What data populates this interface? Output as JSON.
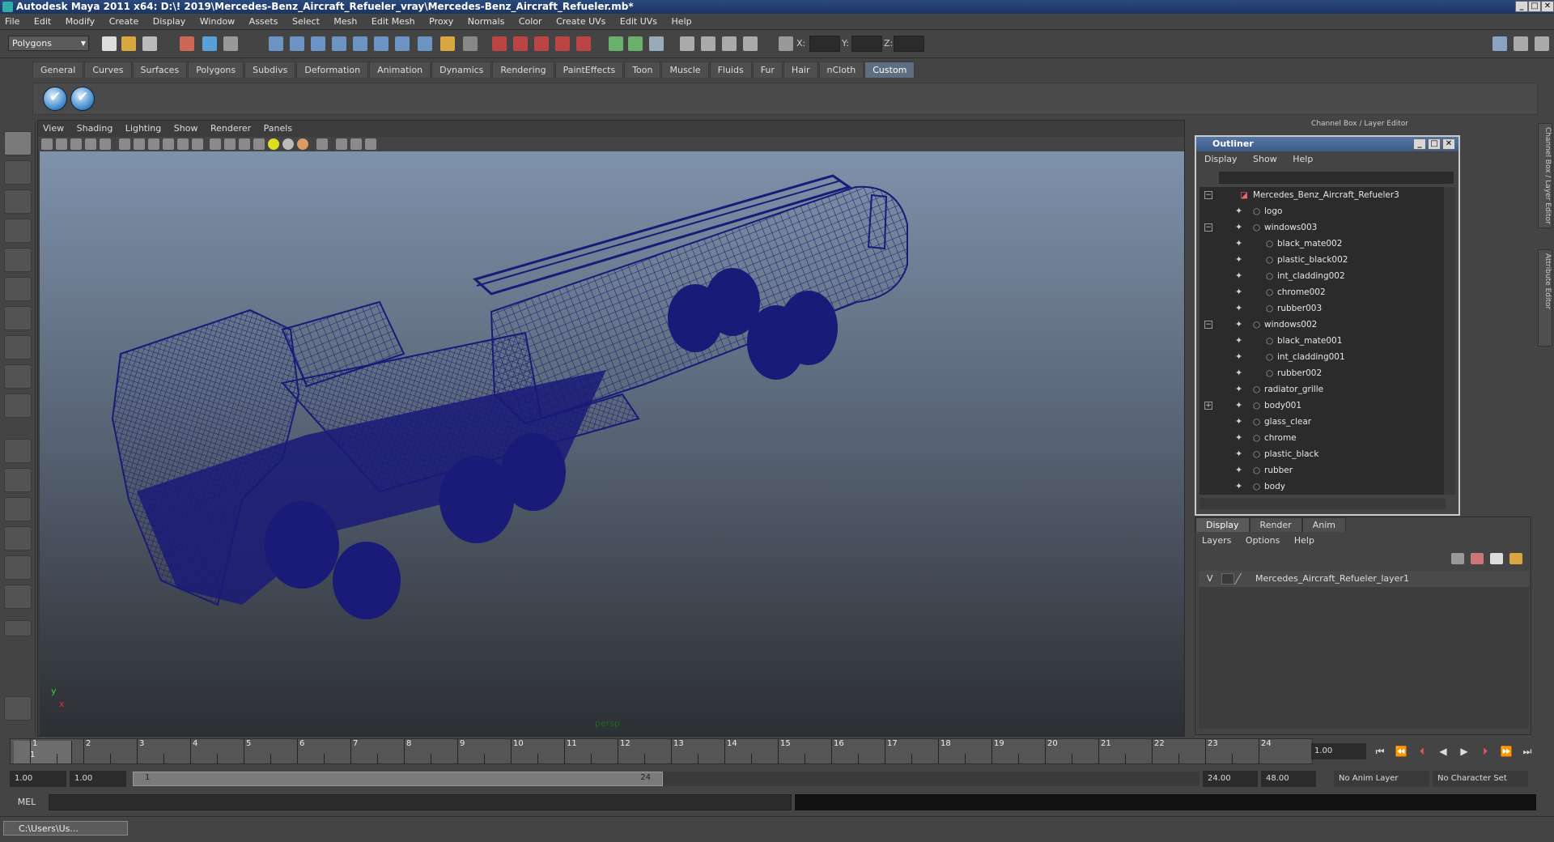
{
  "titlebar": {
    "title": "Autodesk Maya 2011 x64: D:\\! 2019\\Mercedes-Benz_Aircraft_Refueler_vray\\Mercedes-Benz_Aircraft_Refueler.mb*"
  },
  "menubar": [
    "File",
    "Edit",
    "Modify",
    "Create",
    "Display",
    "Window",
    "Assets",
    "Select",
    "Mesh",
    "Edit Mesh",
    "Proxy",
    "Normals",
    "Color",
    "Create UVs",
    "Edit UVs",
    "Help"
  ],
  "status": {
    "mode": "Polygons",
    "x_label": "X:",
    "y_label": "Y:",
    "z_label": "Z:"
  },
  "shelf": {
    "tabs": [
      "General",
      "Curves",
      "Surfaces",
      "Polygons",
      "Subdivs",
      "Deformation",
      "Animation",
      "Dynamics",
      "Rendering",
      "PaintEffects",
      "Toon",
      "Muscle",
      "Fluids",
      "Fur",
      "Hair",
      "nCloth",
      "Custom"
    ],
    "active": "Custom"
  },
  "viewport": {
    "menu": [
      "View",
      "Shading",
      "Lighting",
      "Show",
      "Renderer",
      "Panels"
    ],
    "camera": "persp",
    "axis_y": "y",
    "axis_x": "x",
    "wire_color": "#1a1a78"
  },
  "channel_box_title": "Channel Box / Layer Editor",
  "side_tabs": [
    "Channel Box / Layer Editor",
    "Attribute Editor"
  ],
  "outliner": {
    "title": "Outliner",
    "menu": [
      "Display",
      "Show",
      "Help"
    ],
    "root": "Mercedes_Benz_Aircraft_Refueler3",
    "rows": [
      {
        "label": "logo",
        "depth": 1,
        "exp": ""
      },
      {
        "label": "windows003",
        "depth": 1,
        "exp": "−"
      },
      {
        "label": "black_mate002",
        "depth": 2,
        "exp": ""
      },
      {
        "label": "plastic_black002",
        "depth": 2,
        "exp": ""
      },
      {
        "label": "int_cladding002",
        "depth": 2,
        "exp": ""
      },
      {
        "label": "chrome002",
        "depth": 2,
        "exp": ""
      },
      {
        "label": "rubber003",
        "depth": 2,
        "exp": ""
      },
      {
        "label": "windows002",
        "depth": 1,
        "exp": "−"
      },
      {
        "label": "black_mate001",
        "depth": 2,
        "exp": ""
      },
      {
        "label": "int_cladding001",
        "depth": 2,
        "exp": ""
      },
      {
        "label": "rubber002",
        "depth": 2,
        "exp": ""
      },
      {
        "label": "radiator_grille",
        "depth": 1,
        "exp": ""
      },
      {
        "label": "body001",
        "depth": 1,
        "exp": "+"
      },
      {
        "label": "glass_clear",
        "depth": 1,
        "exp": ""
      },
      {
        "label": "chrome",
        "depth": 1,
        "exp": ""
      },
      {
        "label": "plastic_black",
        "depth": 1,
        "exp": ""
      },
      {
        "label": "rubber",
        "depth": 1,
        "exp": ""
      },
      {
        "label": "body",
        "depth": 1,
        "exp": ""
      }
    ]
  },
  "layers": {
    "tabs": [
      "Display",
      "Render",
      "Anim"
    ],
    "active": "Display",
    "menu": [
      "Layers",
      "Options",
      "Help"
    ],
    "visible_flag": "V",
    "layer_name": "Mercedes_Aircraft_Refueler_layer1"
  },
  "timeline": {
    "ticks": [
      "1",
      "2",
      "3",
      "4",
      "5",
      "6",
      "7",
      "8",
      "9",
      "10",
      "11",
      "12",
      "13",
      "14",
      "15",
      "16",
      "17",
      "18",
      "19",
      "20",
      "21",
      "22",
      "23",
      "24"
    ],
    "start_marker": "1",
    "current_frame": "1.00"
  },
  "range": {
    "start": "1.00",
    "start2": "1.00",
    "slider_start": "1",
    "slider_end": "24",
    "end": "24.00",
    "end2": "48.00",
    "anim_layer": "No Anim Layer",
    "char_set": "No Character Set"
  },
  "command": {
    "mel": "MEL"
  },
  "taskbar": {
    "item": "C:\\Users\\Us..."
  }
}
